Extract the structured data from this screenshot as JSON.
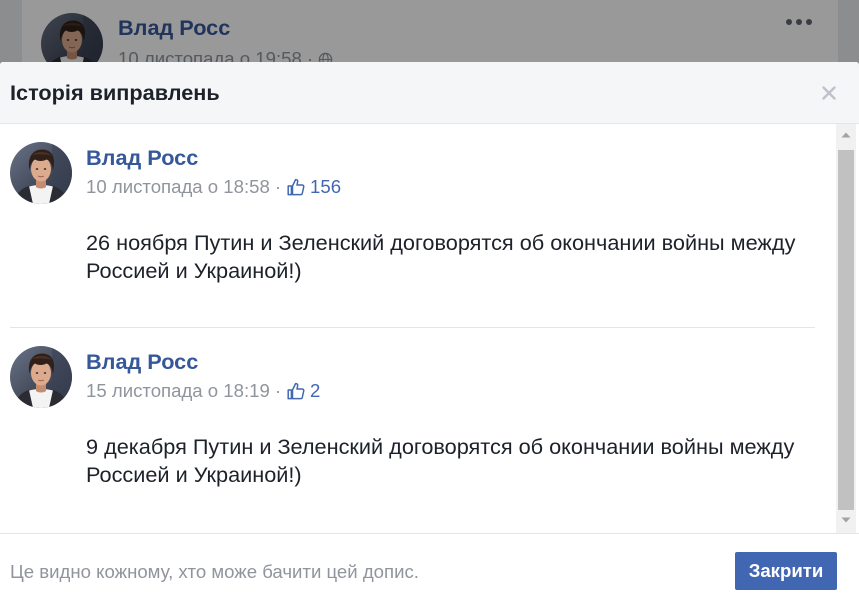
{
  "separator": "·",
  "background_post": {
    "author": "Влад Росс",
    "timestamp": "10 листопада о 19:58",
    "privacy_icon": "globe-icon",
    "menu_icon": "more-options-icon"
  },
  "dialog": {
    "title": "Історія виправлень",
    "close_icon": "close-icon",
    "revisions": [
      {
        "author": "Влад Росс",
        "timestamp": "10 листопада о 18:58",
        "like_icon": "like-icon",
        "likes": "156",
        "text_lines": [
          "26 ноября Путин и Зеленский договорятся об окончании войны между",
          "Россией и Украиной!)"
        ]
      },
      {
        "author": "Влад Росс",
        "timestamp": "15 листопада о 18:19",
        "like_icon": "like-icon",
        "likes": "2",
        "text_lines": [
          "9 декабря Путин и Зеленский договорятся об окончании войны между",
          "Россией и Украиной!)"
        ]
      }
    ],
    "footer_note": "Це видно кожному, хто може бачити цей допис.",
    "close_button_label": "Закрити"
  },
  "colors": {
    "page_bg": "#e9ebee",
    "link_blue": "#365899",
    "button_blue": "#4267b2",
    "meta_gray": "#90949c",
    "text": "#1d2129",
    "header_bg": "#f5f6f7",
    "divider": "#e5e5e5",
    "overlay": "rgba(0,0,0,0.4)"
  }
}
